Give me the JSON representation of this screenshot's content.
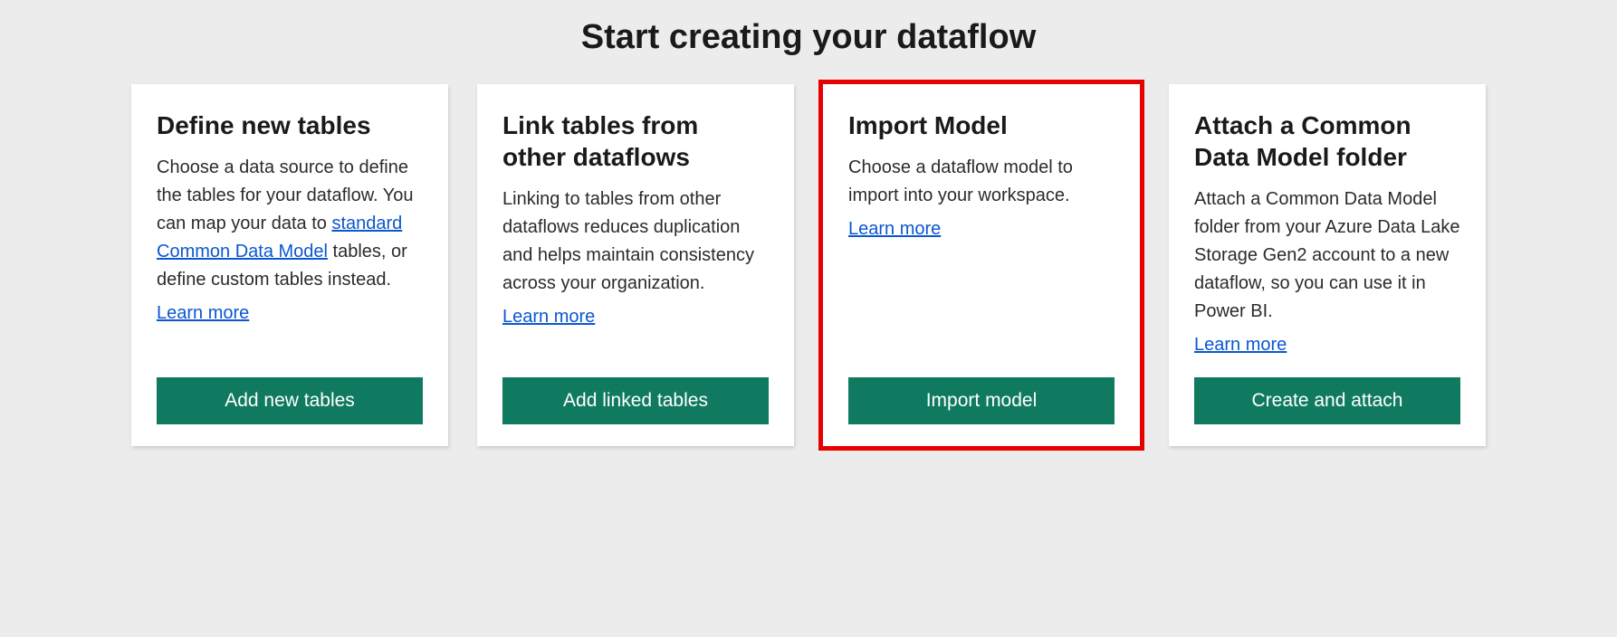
{
  "page_title": "Start creating your dataflow",
  "cards": [
    {
      "title": "Define new tables",
      "desc_before": "Choose a data source to define the tables for your dataflow. You can map your data to ",
      "desc_link": "standard Common Data Model",
      "desc_after": " tables, or define custom tables instead.",
      "learn_more": "Learn more",
      "button": "Add new tables"
    },
    {
      "title": "Link tables from other dataflows",
      "desc": "Linking to tables from other dataflows reduces duplication and helps maintain consistency across your organization.",
      "learn_more": "Learn more",
      "button": "Add linked tables"
    },
    {
      "title": "Import Model",
      "desc": "Choose a dataflow model to import into your workspace.",
      "learn_more": "Learn more",
      "button": "Import model"
    },
    {
      "title": "Attach a Common Data Model folder",
      "desc": "Attach a Common Data Model folder from your Azure Data Lake Storage Gen2 account to a new dataflow, so you can use it in Power BI.",
      "learn_more": "Learn more",
      "button": "Create and attach"
    }
  ]
}
